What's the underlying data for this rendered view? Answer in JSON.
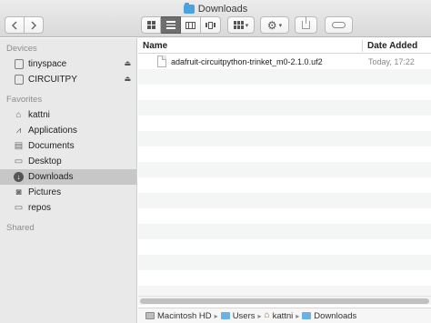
{
  "window": {
    "title": "Downloads"
  },
  "toolbar": {
    "back_icon": "chevron-left-icon",
    "forward_icon": "chevron-right-icon",
    "views": [
      "icon-view",
      "list-view",
      "column-view",
      "cover-flow-view"
    ],
    "active_view": "list-view",
    "arrange_icon": "arrange-icon",
    "action_icon": "gear-icon",
    "share_icon": "share-icon",
    "tag_icon": "tag-icon"
  },
  "sidebar": {
    "devices_header": "Devices",
    "devices": [
      {
        "label": "tinyspace",
        "icon": "disk-icon",
        "eject": "⏏"
      },
      {
        "label": "CIRCUITPY",
        "icon": "disk-icon",
        "eject": "⏏"
      }
    ],
    "favorites_header": "Favorites",
    "favorites": [
      {
        "label": "kattni",
        "icon": "home-icon"
      },
      {
        "label": "Applications",
        "icon": "applications-icon"
      },
      {
        "label": "Documents",
        "icon": "documents-icon"
      },
      {
        "label": "Desktop",
        "icon": "desktop-icon"
      },
      {
        "label": "Downloads",
        "icon": "downloads-icon"
      },
      {
        "label": "Pictures",
        "icon": "pictures-icon"
      },
      {
        "label": "repos",
        "icon": "folder-icon"
      }
    ],
    "selected": "Downloads",
    "shared_header": "Shared"
  },
  "list": {
    "columns": {
      "name": "Name",
      "date_added": "Date Added"
    },
    "files": [
      {
        "name": "adafruit-circuitpython-trinket_m0-2.1.0.uf2",
        "date_added": "Today, 17:22",
        "icon": "document-icon"
      }
    ]
  },
  "pathbar": {
    "crumbs": [
      {
        "label": "Macintosh HD",
        "icon": "hard-disk-icon"
      },
      {
        "label": "Users",
        "icon": "folder-icon"
      },
      {
        "label": "kattni",
        "icon": "home-icon"
      },
      {
        "label": "Downloads",
        "icon": "downloads-folder-icon"
      }
    ]
  },
  "colors": {
    "sidebar_bg": "#e9e9e9",
    "selected_bg": "#c7c7c7",
    "folder_blue": "#4aa3e0",
    "toolbar_bg": "#dcdcdc"
  }
}
